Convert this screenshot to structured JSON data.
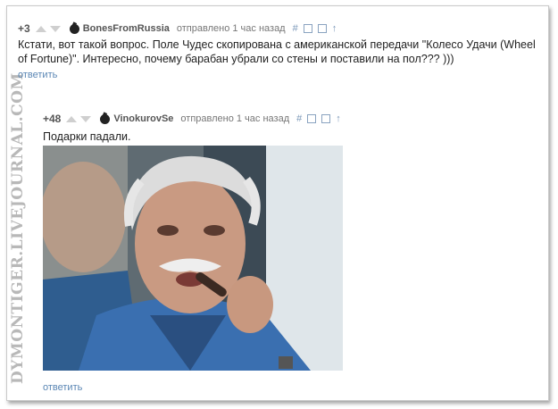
{
  "watermark": "DYMONTIGER.LIVEJOURNAL.COM",
  "comments": [
    {
      "score": "+3",
      "username": "BonesFromRussia",
      "sent": "отправлено 1 час назад",
      "actions": {
        "hash": "#",
        "up_arrow": "↑"
      },
      "text": "Кстати, вот такой вопрос. Поле Чудес скопирована с американской передачи \"Колесо Удачи (Wheel of Fortune)\". Интересно, почему барабан убрали со стены и поставили на пол??? )))",
      "reply": "ответить"
    },
    {
      "score": "+48",
      "username": "VinokurovSe",
      "sent": "отправлено 1 час назад",
      "actions": {
        "hash": "#",
        "up_arrow": "↑"
      },
      "text": "Подарки падали.",
      "reply": "ответить"
    }
  ]
}
